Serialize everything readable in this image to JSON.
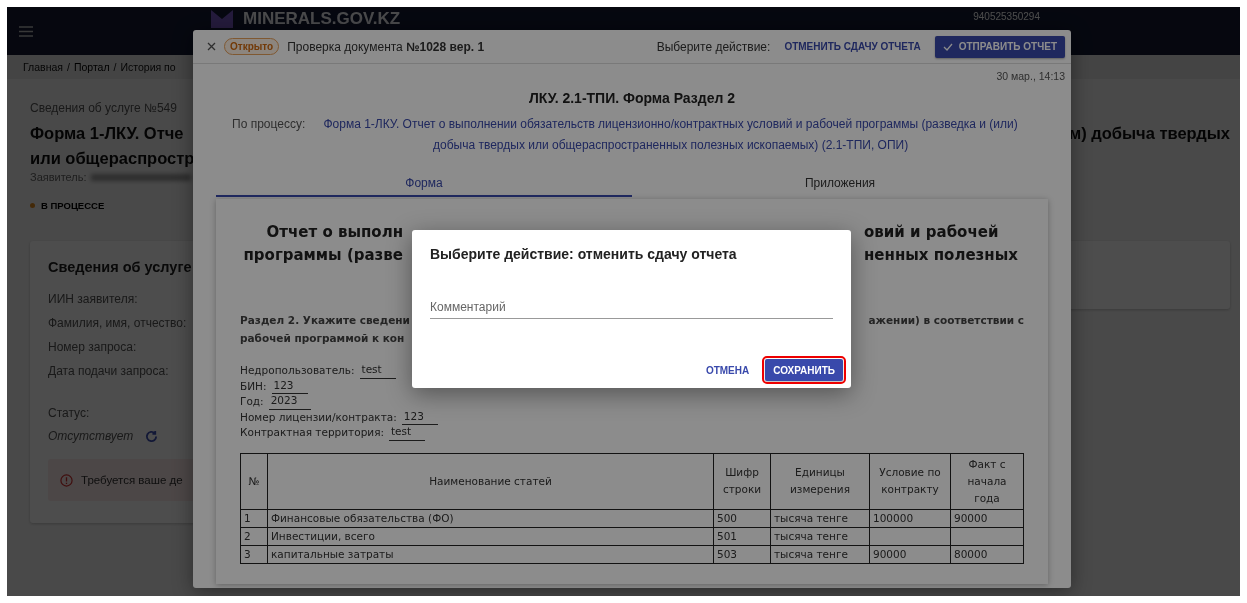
{
  "page": {
    "logo": "MINERALS.GOV.KZ",
    "user_id": "940525350294",
    "breadcrumbs": [
      "Главная",
      "Портал",
      "История по"
    ],
    "breadcrumb_separator": "/",
    "service_number": "Сведения об услуге №549",
    "title_left": [
      "Форма 1-ЛКУ. Отче",
      "или общераспростр"
    ],
    "title_right": "м) добыча твердых",
    "applicant_label": "Заявитель:",
    "status_badge": "В ПРОЦЕССЕ",
    "card": {
      "title": "Сведения об услуге",
      "fields": [
        "ИИН заявителя:",
        "Фамилия, имя, отчество:",
        "Номер запроса:",
        "Дата подачи запроса:"
      ],
      "status_label": "Статус:",
      "status_value": "Отсутствует",
      "alert": "Требуется ваше де"
    }
  },
  "document_modal": {
    "status_chip": "Открыто",
    "title": "Проверка документа **№1028 вер. 1**",
    "action_label": "Выберите действие:",
    "actions": [
      {
        "label": "ОТМЕНИТЬ СДАЧУ ОТЧЕТА",
        "kind": "text"
      },
      {
        "label": "ОТПРАВИТЬ ОТЧЕТ",
        "kind": "primary"
      }
    ],
    "date": "30 мар., 14:13",
    "form_title": "ЛКУ. 2.1-ТПИ. Форма Раздел 2",
    "process_label": "По процессу:",
    "process_link": "Форма 1-ЛКУ. Отчет о выполнении обязательств лицензионно/контрактных условий и рабочей программы (разведка и (или) добыча твердых или общераспространенных полезных ископаемых) (2.1-ТПИ, ОПИ)",
    "tabs": [
      {
        "label": "Форма",
        "selected": true
      },
      {
        "label": "Приложения",
        "selected": false
      }
    ],
    "report": {
      "heading_left": [
        "Отчет о выполн",
        "программы (разве"
      ],
      "heading_right": [
        "овий и рабочей",
        "ненных полезных"
      ],
      "section_left": [
        "Раздел 2. Укажите сведени",
        "рабочей программой к кон"
      ],
      "section_right": "ажении) в соответствии с",
      "fields": [
        {
          "label": "Недропользователь:",
          "value": "test"
        },
        {
          "label": "БИН:",
          "value": "123"
        },
        {
          "label": "Год:",
          "value": "2023"
        },
        {
          "label": "Номер лицензии/контракта:",
          "value": "123"
        },
        {
          "label": "Контрактная территория:",
          "value": "test"
        }
      ],
      "table": {
        "columns": [
          "№",
          "Наименование статей",
          "Шифр строки",
          "Единицы измерения",
          "Условие по контракту",
          "Факт с начала года"
        ],
        "rows": [
          [
            "1",
            "Финансовые обязательства (ФО)",
            "500",
            "тысяча тенге",
            "100000",
            "90000"
          ],
          [
            "2",
            "Инвестиции, всего",
            "501",
            "тысяча тенге",
            "",
            ""
          ],
          [
            "3",
            "капитальные затраты",
            "503",
            "тысяча тенге",
            "90000",
            "80000"
          ]
        ]
      }
    }
  },
  "dialog": {
    "title": "Выберите действие: отменить сдачу отчета",
    "comment_placeholder": "Комментарий",
    "buttons": [
      {
        "label": "ОТМЕНА",
        "kind": "text",
        "highlighted": false
      },
      {
        "label": "СОХРАНИТЬ",
        "kind": "primary",
        "highlighted": true
      }
    ]
  }
}
